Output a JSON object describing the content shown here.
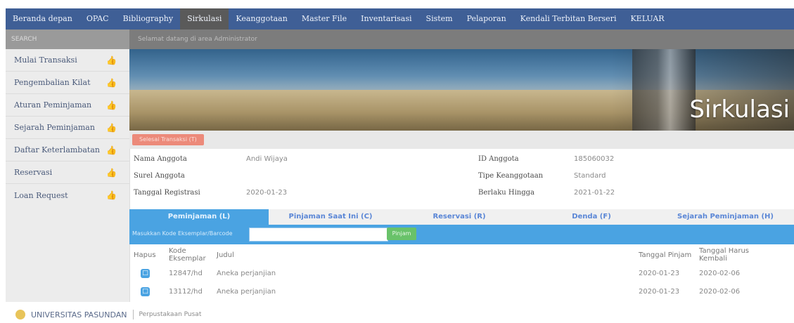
{
  "nav": {
    "items": [
      "Beranda depan",
      "OPAC",
      "Bibliography",
      "Sirkulasi",
      "Keanggotaan",
      "Master File",
      "Inventarisasi",
      "Sistem",
      "Pelaporan",
      "Kendali Terbitan Berseri",
      "KELUAR"
    ],
    "active_index": 3
  },
  "subhead": {
    "left": "SEARCH",
    "right": "Selamat datang di area Administrator"
  },
  "sidebar": {
    "items": [
      {
        "label": "Mulai Transaksi"
      },
      {
        "label": "Pengembalian Kilat"
      },
      {
        "label": "Aturan Peminjaman"
      },
      {
        "label": "Sejarah Peminjaman"
      },
      {
        "label": "Daftar Keterlambatan"
      },
      {
        "label": "Reservasi"
      },
      {
        "label": "Loan Request"
      }
    ]
  },
  "banner": {
    "title": "Sirkulasi"
  },
  "action": {
    "finish_label": "Selesai Transaksi (T)"
  },
  "member": {
    "name_label": "Nama Anggota",
    "name_value": "Andi Wijaya",
    "id_label": "ID Anggota",
    "id_value": "185060032",
    "email_label": "Surel Anggota",
    "email_value": "",
    "type_label": "Tipe Keanggotaan",
    "type_value": "Standard",
    "reg_label": "Tanggal Registrasi",
    "reg_value": "2020-01-23",
    "until_label": "Berlaku Hingga",
    "until_value": "2021-01-22"
  },
  "tabs": [
    {
      "label": "Peminjaman (L)"
    },
    {
      "label": "Pinjaman Saat Ini (C)"
    },
    {
      "label": "Reservasi (R)"
    },
    {
      "label": "Denda (F)"
    },
    {
      "label": "Sejarah Peminjaman (H)"
    }
  ],
  "loan": {
    "label": "Masukkan Kode Eksemplar/Barcode",
    "input_value": "",
    "button_label": "Pinjam"
  },
  "table": {
    "headers": {
      "hapus": "Hapus",
      "kode": "Kode Eksemplar",
      "judul": "Judul",
      "pinjam": "Tanggal Pinjam",
      "kembali": "Tanggal Harus Kembali"
    },
    "rows": [
      {
        "kode": "12847/hd",
        "judul": "Aneka perjanjian",
        "pinjam": "2020-01-23",
        "kembali": "2020-02-06"
      },
      {
        "kode": "13112/hd",
        "judul": "Aneka perjanjian",
        "pinjam": "2020-01-23",
        "kembali": "2020-02-06"
      }
    ]
  },
  "footer": {
    "brand": "UNIVERSITAS PASUNDAN",
    "sub": "Perpustakaan Pusat"
  },
  "colors": {
    "nav_bg": "#3f5f96",
    "tab_active": "#4aa3e2",
    "button_green": "#69c26a",
    "finish_red": "#ec8a7a"
  }
}
